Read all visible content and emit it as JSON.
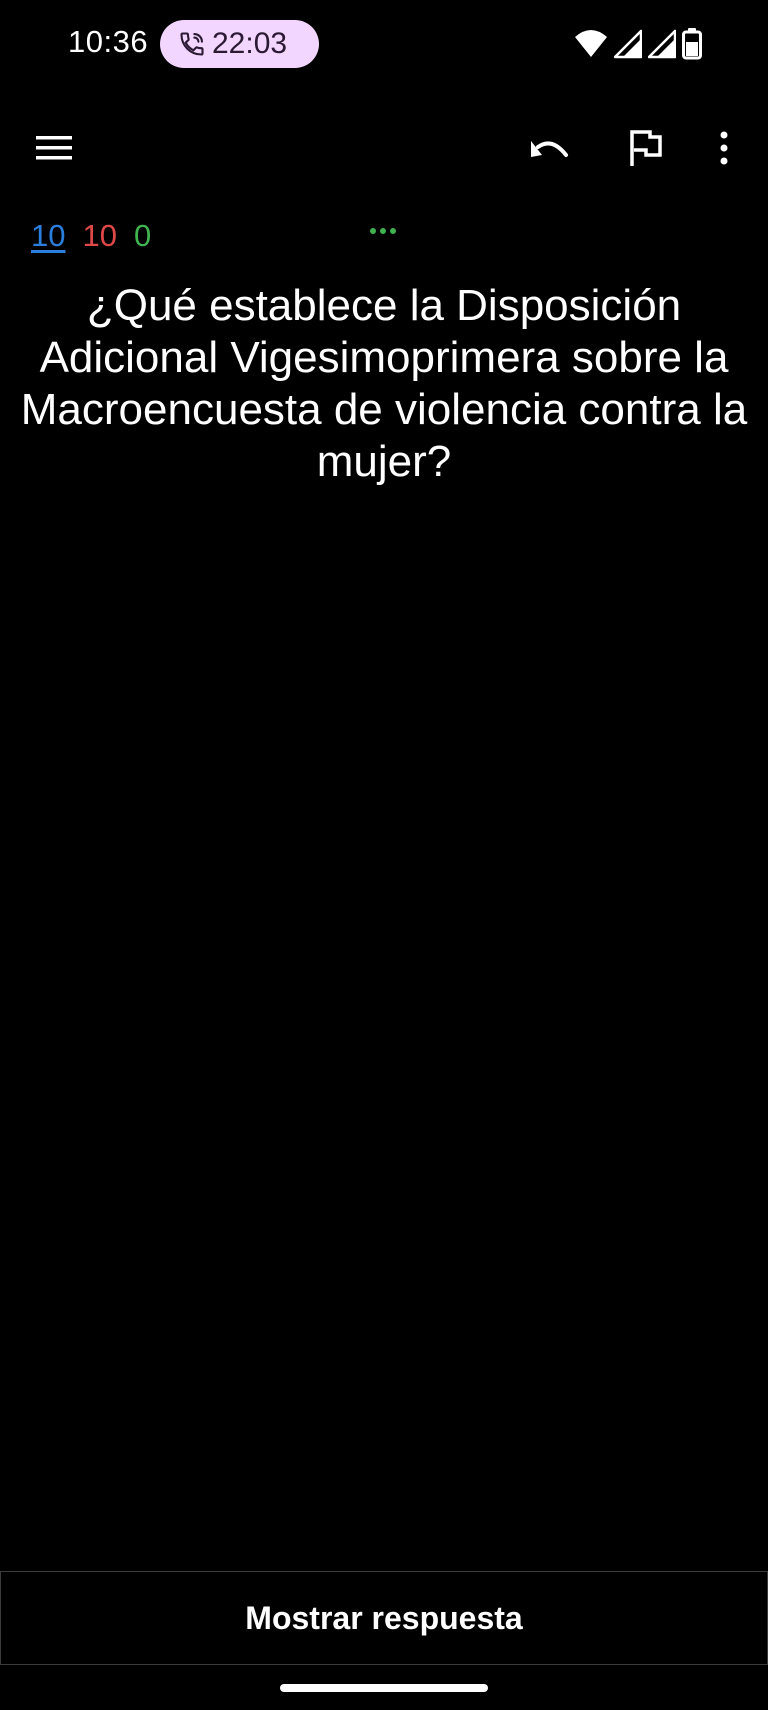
{
  "status_bar": {
    "time": "10:36",
    "call_timer": "22:03",
    "icons": [
      "phone-call-icon",
      "wifi-icon",
      "signal-icon",
      "signal-icon",
      "battery-icon"
    ],
    "pill_color": "#f3d6ff"
  },
  "toolbar": {
    "icons": [
      "menu-icon",
      "undo-icon",
      "flag-icon",
      "more-vert-icon"
    ]
  },
  "counters": {
    "new": "10",
    "learning": "10",
    "review": "0",
    "colors": {
      "new": "#2a7fdc",
      "learning": "#e04848",
      "review": "#3fb34f"
    }
  },
  "card": {
    "question": "¿Qué establece la Disposición Adicional Vigesimoprimera sobre la Macroencuesta de violencia contra la mujer?"
  },
  "answer_button": {
    "label": "Mostrar respuesta"
  }
}
